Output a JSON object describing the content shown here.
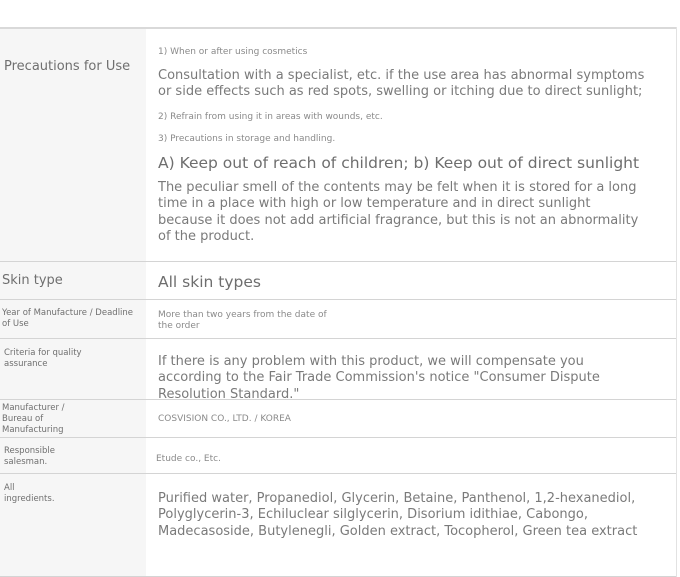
{
  "rows": {
    "precautions": {
      "label": "Precautions for Use",
      "item1_heading": "1) When or after using cosmetics",
      "item1_text": "Consultation with a specialist, etc. if the use area has abnormal symptoms or side effects such as red spots, swelling or itching due to direct sunlight;",
      "item2_heading": "2) Refrain from using it in areas with wounds, etc.",
      "item3_heading": "3) Precautions in storage and handling.",
      "item3_text": "A) Keep out of reach of children; b) Keep out of direct sunlight",
      "note": "The peculiar smell of the contents may be felt when it is stored for a long time in a place with high or low temperature and in direct sunlight because it does not add artificial fragrance, but this is not an abnormality of the product."
    },
    "skin_type": {
      "label": "Skin type",
      "value": "All skin types"
    },
    "manufacture": {
      "label": "Year of Manufacture / Deadline of Use",
      "value": "More than two years from the date of the order"
    },
    "quality": {
      "label": "Criteria for quality assurance",
      "value": "If there is any problem with this product, we will compensate you according to the Fair Trade Commission's notice \"Consumer Dispute Resolution Standard.\""
    },
    "manufacturer": {
      "label": "Manufacturer / Bureau of Manufacturing",
      "value": "COSVISION CO., LTD. / KOREA"
    },
    "salesman": {
      "label": "Responsible salesman.",
      "value": "Etude co., Etc."
    },
    "ingredients": {
      "label": "All ingredients.",
      "value": "Purified water, Propanediol, Glycerin, Betaine, Panthenol, 1,2-hexanediol, Polyglycerin-3, Echiluclear silglycerin, Disorium idithiae, Cabongo, Madecasoside, Butylenegli, Golden extract, Tocopherol, Green tea extract"
    }
  }
}
